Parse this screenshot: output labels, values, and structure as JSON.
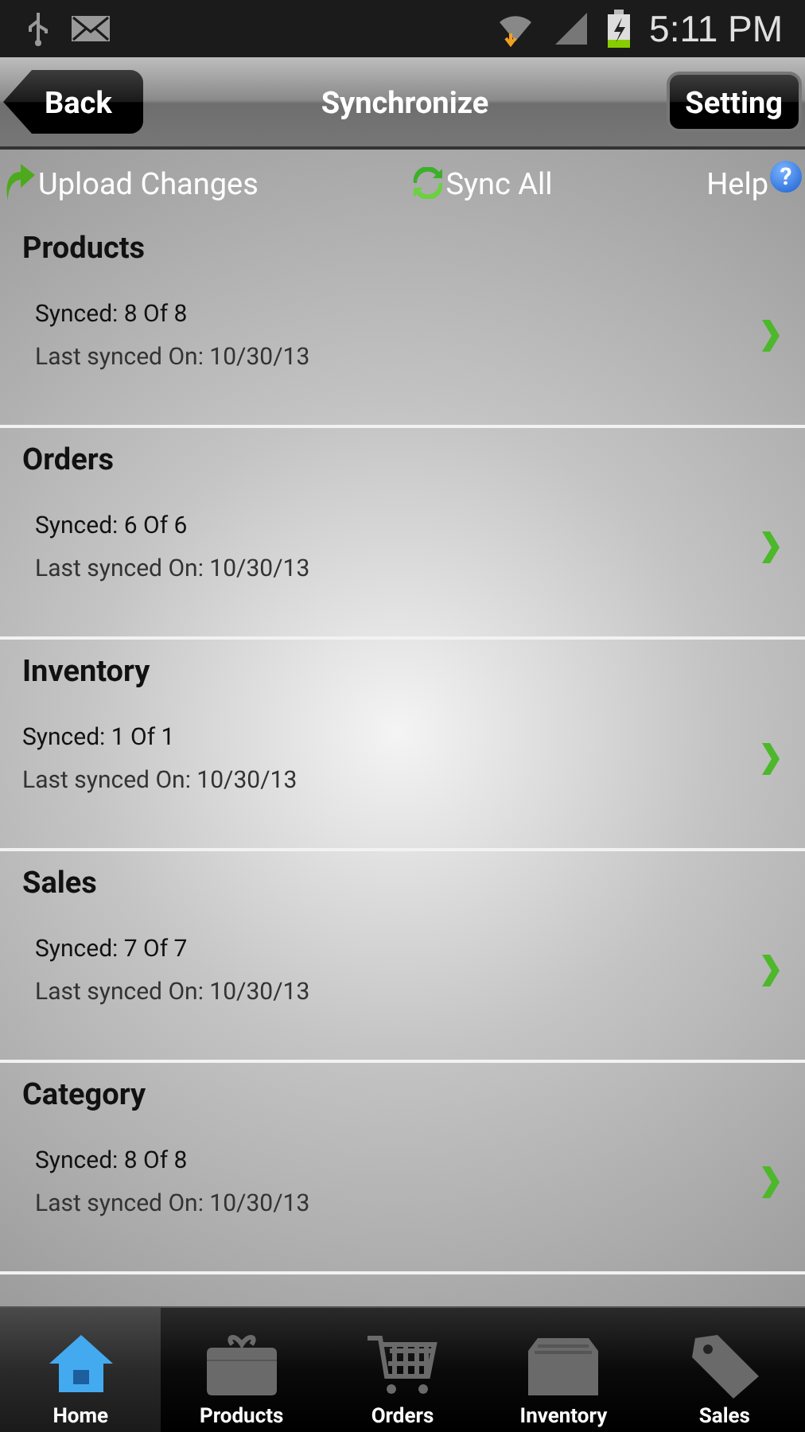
{
  "status_bar": {
    "time": "5:11 PM"
  },
  "nav_bar": {
    "back": "Back",
    "title": "Synchronize",
    "setting": "Setting"
  },
  "toolbar": {
    "upload": "Upload Changes",
    "sync_all": "Sync All",
    "help": "Help",
    "help_icon": "?"
  },
  "sections": [
    {
      "title": "Products",
      "synced": "Synced: 8 Of 8",
      "last": "Last synced On: 10/30/13",
      "inset": true
    },
    {
      "title": "Orders",
      "synced": "Synced: 6 Of 6",
      "last": "Last synced On: 10/30/13",
      "inset": true
    },
    {
      "title": "Inventory",
      "synced": "Synced: 1 Of 1",
      "last": "Last synced On: 10/30/13",
      "inset": false
    },
    {
      "title": "Sales",
      "synced": "Synced: 7 Of 7",
      "last": "Last synced On: 10/30/13",
      "inset": true
    },
    {
      "title": "Category",
      "synced": "Synced: 8 Of 8",
      "last": "Last synced On: 10/30/13",
      "inset": true
    }
  ],
  "tabs": [
    {
      "label": "Home",
      "kind": "home",
      "selected": true
    },
    {
      "label": "Products",
      "kind": "gift",
      "selected": false
    },
    {
      "label": "Orders",
      "kind": "cart",
      "selected": false
    },
    {
      "label": "Inventory",
      "kind": "drawer",
      "selected": false
    },
    {
      "label": "Sales",
      "kind": "tag",
      "selected": false
    }
  ]
}
